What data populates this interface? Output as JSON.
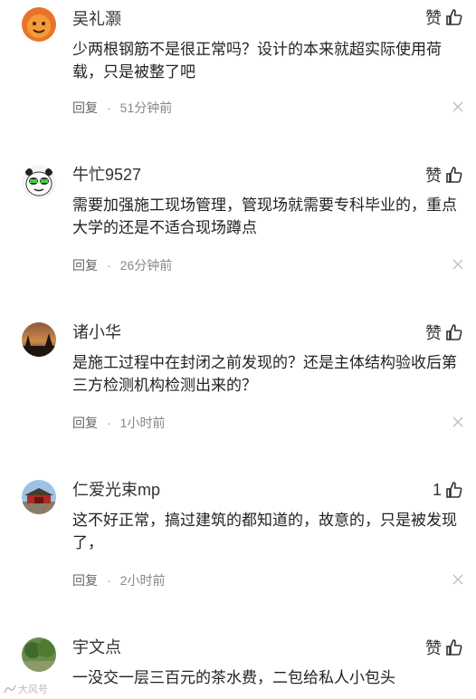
{
  "comments": [
    {
      "username": "吴礼灏",
      "like_label": "赞",
      "text": "少两根钢筋不是很正常吗？设计的本来就超实际使用荷载，只是被整了吧",
      "reply_label": "回复",
      "time": "51分钟前"
    },
    {
      "username": "牛忙9527",
      "like_label": "赞",
      "text": "需要加强施工现场管理，管现场就需要专科毕业的，重点大学的还是不适合现场蹲点",
      "reply_label": "回复",
      "time": "26分钟前"
    },
    {
      "username": "诸小华",
      "like_label": "赞",
      "text": "是施工过程中在封闭之前发现的？还是主体结构验收后第三方检测机构检测出来的？",
      "reply_label": "回复",
      "time": "1小时前"
    },
    {
      "username": "仁爱光束mp",
      "like_label": "1",
      "text": "这不好正常，搞过建筑的都知道的，故意的，只是被发现了，",
      "reply_label": "回复",
      "time": "2小时前"
    },
    {
      "username": "宇文点",
      "like_label": "赞",
      "text": "一没交一层三百元的茶水费，二包给私人小包头",
      "reply_label": "回复",
      "time": ""
    }
  ],
  "icons": {
    "like": "thumbs-up-icon",
    "close": "close-icon"
  },
  "watermark": "大风号"
}
